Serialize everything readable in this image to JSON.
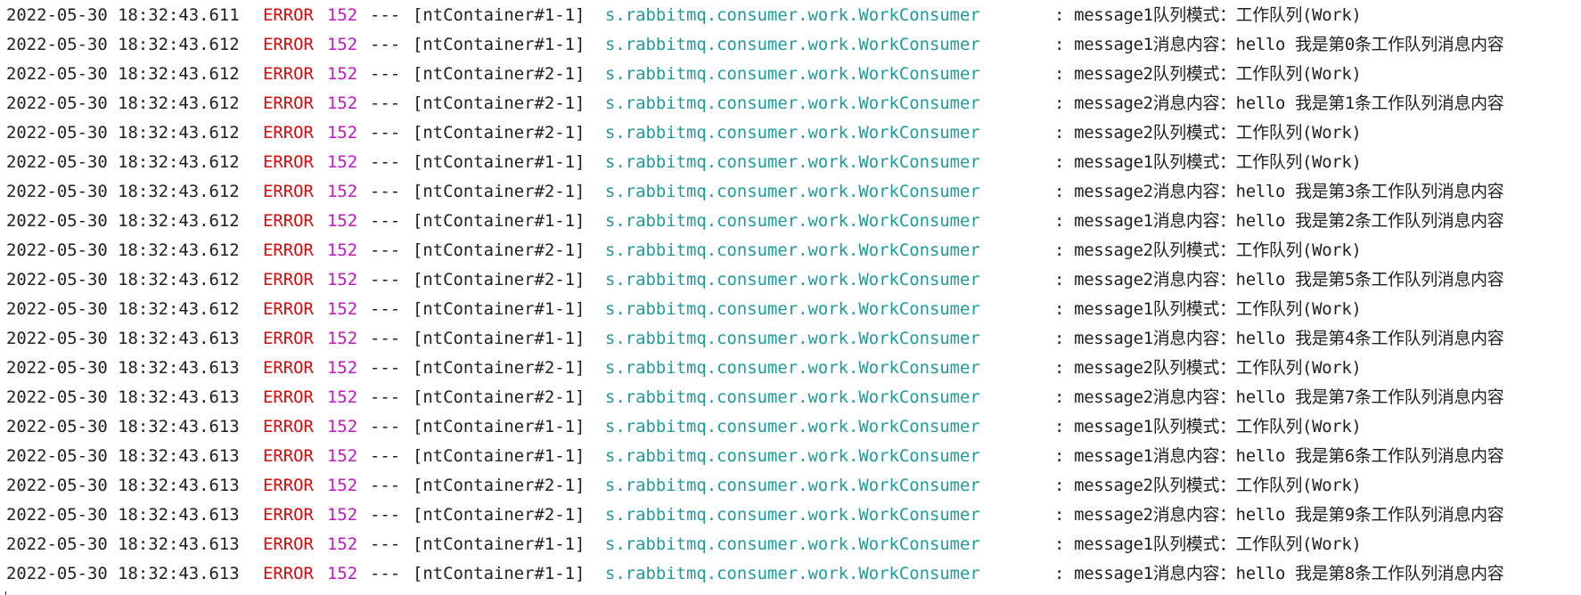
{
  "console": {
    "lines": [
      {
        "ts": "2022-05-30 18:32:43.611",
        "level": "ERROR",
        "pid": "152",
        "sep": "---",
        "thread": "[ntContainer#1-1]",
        "logger": "s.rabbitmq.consumer.work.WorkConsumer",
        "msg": ": message1队列模式：工作队列(Work)"
      },
      {
        "ts": "2022-05-30 18:32:43.612",
        "level": "ERROR",
        "pid": "152",
        "sep": "---",
        "thread": "[ntContainer#1-1]",
        "logger": "s.rabbitmq.consumer.work.WorkConsumer",
        "msg": ": message1消息内容：hello 我是第0条工作队列消息内容"
      },
      {
        "ts": "2022-05-30 18:32:43.612",
        "level": "ERROR",
        "pid": "152",
        "sep": "---",
        "thread": "[ntContainer#2-1]",
        "logger": "s.rabbitmq.consumer.work.WorkConsumer",
        "msg": ": message2队列模式：工作队列(Work)"
      },
      {
        "ts": "2022-05-30 18:32:43.612",
        "level": "ERROR",
        "pid": "152",
        "sep": "---",
        "thread": "[ntContainer#2-1]",
        "logger": "s.rabbitmq.consumer.work.WorkConsumer",
        "msg": ": message2消息内容：hello 我是第1条工作队列消息内容"
      },
      {
        "ts": "2022-05-30 18:32:43.612",
        "level": "ERROR",
        "pid": "152",
        "sep": "---",
        "thread": "[ntContainer#2-1]",
        "logger": "s.rabbitmq.consumer.work.WorkConsumer",
        "msg": ": message2队列模式：工作队列(Work)"
      },
      {
        "ts": "2022-05-30 18:32:43.612",
        "level": "ERROR",
        "pid": "152",
        "sep": "---",
        "thread": "[ntContainer#1-1]",
        "logger": "s.rabbitmq.consumer.work.WorkConsumer",
        "msg": ": message1队列模式：工作队列(Work)"
      },
      {
        "ts": "2022-05-30 18:32:43.612",
        "level": "ERROR",
        "pid": "152",
        "sep": "---",
        "thread": "[ntContainer#2-1]",
        "logger": "s.rabbitmq.consumer.work.WorkConsumer",
        "msg": ": message2消息内容：hello 我是第3条工作队列消息内容"
      },
      {
        "ts": "2022-05-30 18:32:43.612",
        "level": "ERROR",
        "pid": "152",
        "sep": "---",
        "thread": "[ntContainer#1-1]",
        "logger": "s.rabbitmq.consumer.work.WorkConsumer",
        "msg": ": message1消息内容：hello 我是第2条工作队列消息内容"
      },
      {
        "ts": "2022-05-30 18:32:43.612",
        "level": "ERROR",
        "pid": "152",
        "sep": "---",
        "thread": "[ntContainer#2-1]",
        "logger": "s.rabbitmq.consumer.work.WorkConsumer",
        "msg": ": message2队列模式：工作队列(Work)"
      },
      {
        "ts": "2022-05-30 18:32:43.612",
        "level": "ERROR",
        "pid": "152",
        "sep": "---",
        "thread": "[ntContainer#2-1]",
        "logger": "s.rabbitmq.consumer.work.WorkConsumer",
        "msg": ": message2消息内容：hello 我是第5条工作队列消息内容"
      },
      {
        "ts": "2022-05-30 18:32:43.612",
        "level": "ERROR",
        "pid": "152",
        "sep": "---",
        "thread": "[ntContainer#1-1]",
        "logger": "s.rabbitmq.consumer.work.WorkConsumer",
        "msg": ": message1队列模式：工作队列(Work)"
      },
      {
        "ts": "2022-05-30 18:32:43.613",
        "level": "ERROR",
        "pid": "152",
        "sep": "---",
        "thread": "[ntContainer#1-1]",
        "logger": "s.rabbitmq.consumer.work.WorkConsumer",
        "msg": ": message1消息内容：hello 我是第4条工作队列消息内容"
      },
      {
        "ts": "2022-05-30 18:32:43.613",
        "level": "ERROR",
        "pid": "152",
        "sep": "---",
        "thread": "[ntContainer#2-1]",
        "logger": "s.rabbitmq.consumer.work.WorkConsumer",
        "msg": ": message2队列模式：工作队列(Work)"
      },
      {
        "ts": "2022-05-30 18:32:43.613",
        "level": "ERROR",
        "pid": "152",
        "sep": "---",
        "thread": "[ntContainer#2-1]",
        "logger": "s.rabbitmq.consumer.work.WorkConsumer",
        "msg": ": message2消息内容：hello 我是第7条工作队列消息内容"
      },
      {
        "ts": "2022-05-30 18:32:43.613",
        "level": "ERROR",
        "pid": "152",
        "sep": "---",
        "thread": "[ntContainer#1-1]",
        "logger": "s.rabbitmq.consumer.work.WorkConsumer",
        "msg": ": message1队列模式：工作队列(Work)"
      },
      {
        "ts": "2022-05-30 18:32:43.613",
        "level": "ERROR",
        "pid": "152",
        "sep": "---",
        "thread": "[ntContainer#1-1]",
        "logger": "s.rabbitmq.consumer.work.WorkConsumer",
        "msg": ": message1消息内容：hello 我是第6条工作队列消息内容"
      },
      {
        "ts": "2022-05-30 18:32:43.613",
        "level": "ERROR",
        "pid": "152",
        "sep": "---",
        "thread": "[ntContainer#2-1]",
        "logger": "s.rabbitmq.consumer.work.WorkConsumer",
        "msg": ": message2队列模式：工作队列(Work)"
      },
      {
        "ts": "2022-05-30 18:32:43.613",
        "level": "ERROR",
        "pid": "152",
        "sep": "---",
        "thread": "[ntContainer#2-1]",
        "logger": "s.rabbitmq.consumer.work.WorkConsumer",
        "msg": ": message2消息内容：hello 我是第9条工作队列消息内容"
      },
      {
        "ts": "2022-05-30 18:32:43.613",
        "level": "ERROR",
        "pid": "152",
        "sep": "---",
        "thread": "[ntContainer#1-1]",
        "logger": "s.rabbitmq.consumer.work.WorkConsumer",
        "msg": ": message1队列模式：工作队列(Work)"
      },
      {
        "ts": "2022-05-30 18:32:43.613",
        "level": "ERROR",
        "pid": "152",
        "sep": "---",
        "thread": "[ntContainer#1-1]",
        "logger": "s.rabbitmq.consumer.work.WorkConsumer",
        "msg": ": message1消息内容：hello 我是第8条工作队列消息内容"
      }
    ]
  },
  "colors": {
    "background": "#ffffff",
    "text": "#1f1f1f",
    "level_error": "#d60a0a",
    "pid": "#c414c4",
    "logger": "#1d9a9a"
  }
}
